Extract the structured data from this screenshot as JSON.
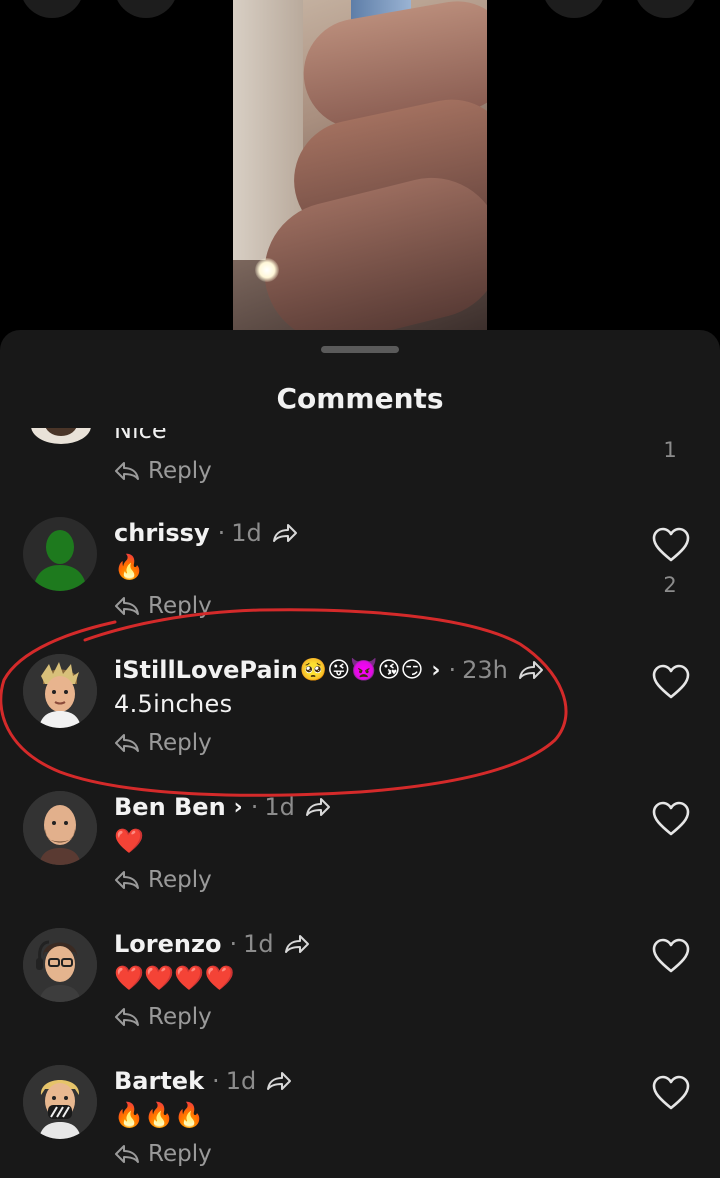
{
  "sheet": {
    "title": "Comments"
  },
  "comments": [
    {
      "name": "",
      "time": "",
      "text": "Nice",
      "reply": "Reply",
      "likes": "1",
      "partial": true
    },
    {
      "name": "chrissy",
      "time": "1d",
      "text": "🔥",
      "reply": "Reply",
      "likes": "2"
    },
    {
      "name": "iStillLovePain",
      "name_emojis": "🥺😜👿😘😏",
      "time": "23h",
      "text": "4.5inches",
      "reply": "Reply",
      "likes": ""
    },
    {
      "name": "Ben Ben",
      "time": "1d",
      "text": "❤️",
      "reply": "Reply",
      "likes": ""
    },
    {
      "name": "Lorenzo",
      "time": "1d",
      "text": "❤️❤️❤️❤️",
      "reply": "Reply",
      "likes": ""
    },
    {
      "name": "Bartek",
      "time": "1d",
      "text": "🔥🔥🔥",
      "reply": "Reply",
      "likes": ""
    }
  ],
  "separator": "·",
  "colors": {
    "sheet_bg": "#181818",
    "annotation": "#d42a2a",
    "secondary_text": "#8c8c8c"
  }
}
